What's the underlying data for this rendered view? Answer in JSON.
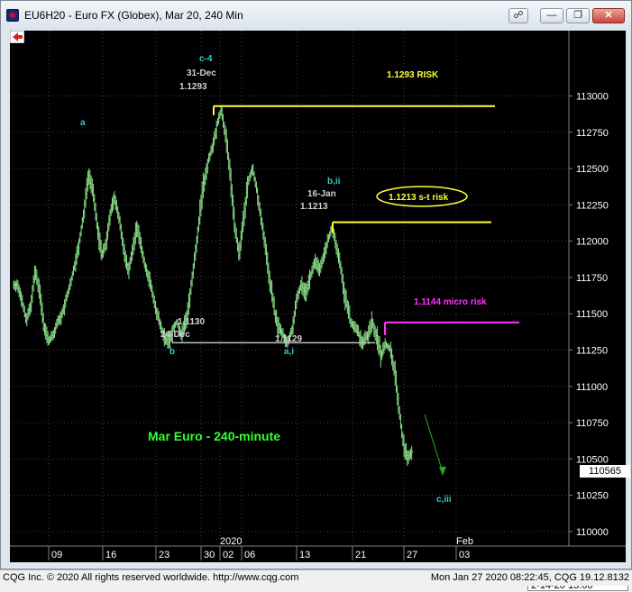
{
  "window": {
    "title": "EU6H20 - Euro FX (Globex), Mar 20, 240 Min",
    "buttons": [
      "link-icon",
      "minimize-icon",
      "restore-icon",
      "close-icon"
    ]
  },
  "status_bar": {
    "left": "CQG Inc. © 2020 All rights reserved worldwide. http://www.cqg.com",
    "right": "Mon Jan 27 2020 08:22:45, CQG 19.12.8132"
  },
  "chart_data": {
    "type": "candlestick",
    "title": "Mar Euro - 240-minute",
    "ylim": [
      109900,
      113450
    ],
    "y_ticks": [
      110000,
      110250,
      110500,
      110750,
      111000,
      111250,
      111500,
      111750,
      112000,
      112250,
      112500,
      112750,
      113000
    ],
    "x_tick_labels": [
      "09",
      "16",
      "23",
      "30",
      "02",
      "06",
      "13",
      "21",
      "27",
      "03"
    ],
    "x_period_labels": [
      "2020",
      "Feb"
    ],
    "last_price": "110565",
    "bottom_field": "2-14-20  13:00",
    "wave_labels": [
      "a",
      "b",
      "c-4",
      "b,ii",
      "a,i",
      "c,iii"
    ],
    "swing_annotations": [
      {
        "date": "31-Dec",
        "price": "1.1293"
      },
      {
        "date": "24-Dec",
        "price": "1.1130"
      },
      {
        "date": "16-Jan",
        "price": "1.1213"
      },
      {
        "date": "",
        "price": "1.1129"
      }
    ],
    "risk_levels": [
      {
        "label": "1.1293 RISK",
        "value": 112930,
        "color": "#ffff33"
      },
      {
        "label": "1.1213 s-t risk",
        "value": 112130,
        "color": "#ffff33"
      },
      {
        "label": "1.1144 micro risk",
        "value": 111440,
        "color": "#ff33ff"
      }
    ],
    "support_level": {
      "value": 111300,
      "color": "#c0c0c0"
    },
    "closes": [
      111700,
      111600,
      111450,
      111550,
      111800,
      111650,
      111400,
      111300,
      111350,
      111450,
      111500,
      111600,
      111700,
      111850,
      112000,
      112200,
      112450,
      112350,
      112100,
      111900,
      112000,
      112200,
      112300,
      112150,
      111950,
      111800,
      111950,
      112100,
      111950,
      111800,
      111700,
      111550,
      111450,
      111350,
      111300,
      111400,
      111450,
      111350,
      111450,
      111650,
      111900,
      112150,
      112400,
      112550,
      112650,
      112800,
      112900,
      112700,
      112450,
      112100,
      111900,
      112150,
      112400,
      112500,
      112350,
      112150,
      111950,
      111700,
      111500,
      111400,
      111350,
      111300,
      111400,
      111600,
      111700,
      111650,
      111750,
      111850,
      111800,
      111900,
      112000,
      112100,
      111950,
      111800,
      111600,
      111450,
      111400,
      111350,
      111300,
      111350,
      111450,
      111350,
      111200,
      111300,
      111250,
      111100,
      110850,
      110600,
      110500,
      110550
    ]
  }
}
